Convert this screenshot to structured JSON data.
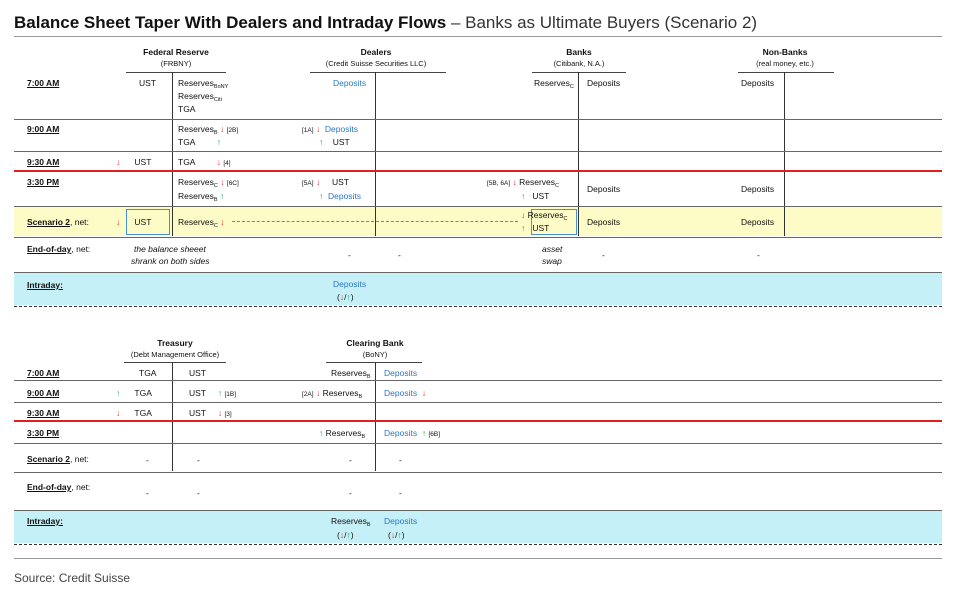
{
  "title": {
    "bold": "Balance Sheet Taper With Dealers and Intraday Flows",
    "rest": " – Banks as Ultimate Buyers (Scenario 2)"
  },
  "source": "Source: Credit Suisse",
  "top": {
    "entities": [
      {
        "name": "Federal Reserve",
        "sub": "(FRBNY)"
      },
      {
        "name": "Dealers",
        "sub": "(Credit Suisse Securities LLC)"
      },
      {
        "name": "Banks",
        "sub": "(Citibank, N.A.)"
      },
      {
        "name": "Non-Banks",
        "sub": "(real money, etc.)"
      }
    ],
    "rows": {
      "t700": "7:00 AM",
      "t900": "9:00 AM",
      "t930": "9:30 AM",
      "t330": "3:30 PM",
      "scen": "Scenario 2",
      "scen_suffix": ", net:",
      "eod": "End-of-day",
      "eod_suffix": ", net:",
      "intraday": "Intraday:"
    },
    "cells": {
      "ust": "UST",
      "reserves": "Reserves",
      "tga": "TGA",
      "deposits": "Deposits",
      "bony": "BoNY",
      "citi": "Citi",
      "b": "B",
      "c": "C",
      "ref2b": "[2B]",
      "ref1a": "[1A]",
      "ref4": "[4]",
      "ref6c": "[6C]",
      "ref5a": "[5A]",
      "ref5b6a": "[5B, 6A]",
      "eod_note1": "the balance sheeet",
      "eod_note2": "shrank on both sides",
      "asset": "asset",
      "swap": "swap",
      "dash": "-",
      "intraday_flow": "(↓/↑)"
    }
  },
  "bottom": {
    "entities": [
      {
        "name": "Treasury",
        "sub": "(Debt Management Office)"
      },
      {
        "name": "Clearing Bank",
        "sub": "(BoNY)"
      }
    ],
    "cells": {
      "ref1b": "[1B]",
      "ref3": "[3]",
      "ref2a": "[2A]",
      "ref6b": "[6B]"
    }
  },
  "colors": {
    "accent_blue": "#2a78c8",
    "decrease_red": "#e02020",
    "increase_green": "#14a050",
    "scenario_band": "#fdfbc6",
    "intraday_band": "#c6f0f7"
  }
}
